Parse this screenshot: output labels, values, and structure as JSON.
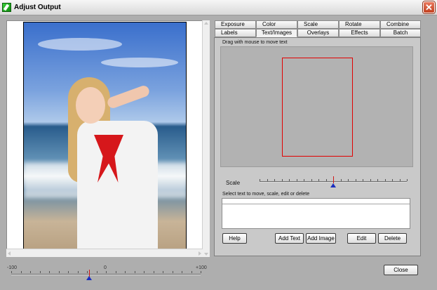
{
  "window": {
    "title": "Adjust Output"
  },
  "tabs": {
    "row1": [
      "Exposure",
      "Color",
      "Scale",
      "Rotate",
      "Combine"
    ],
    "row2": [
      "Labels",
      "Text/Images",
      "Overlays",
      "Effects",
      "Batch"
    ],
    "active": "Text/Images"
  },
  "panel": {
    "drag_hint": "Drag with mouse to move text",
    "scale_label": "Scale",
    "select_hint": "Select text to move, scale, edit or delete"
  },
  "buttons": {
    "help": "Help",
    "add_text": "Add Text",
    "add_image": "Add Image",
    "edit": "Edit",
    "delete": "Delete",
    "close": "Close"
  },
  "preview_slider": {
    "min_label": "-100",
    "mid_label": "0",
    "max_label": "+100",
    "value": -18
  },
  "scale_slider": {
    "value_fraction": 0.5
  },
  "icons": {
    "app": "output-app-icon",
    "close": "close-x-icon",
    "marker": "blue-triangle-marker"
  },
  "colors": {
    "selection_frame": "#e20000",
    "slider_marker": "#1c2fbf",
    "close_button": "#c2401f"
  }
}
